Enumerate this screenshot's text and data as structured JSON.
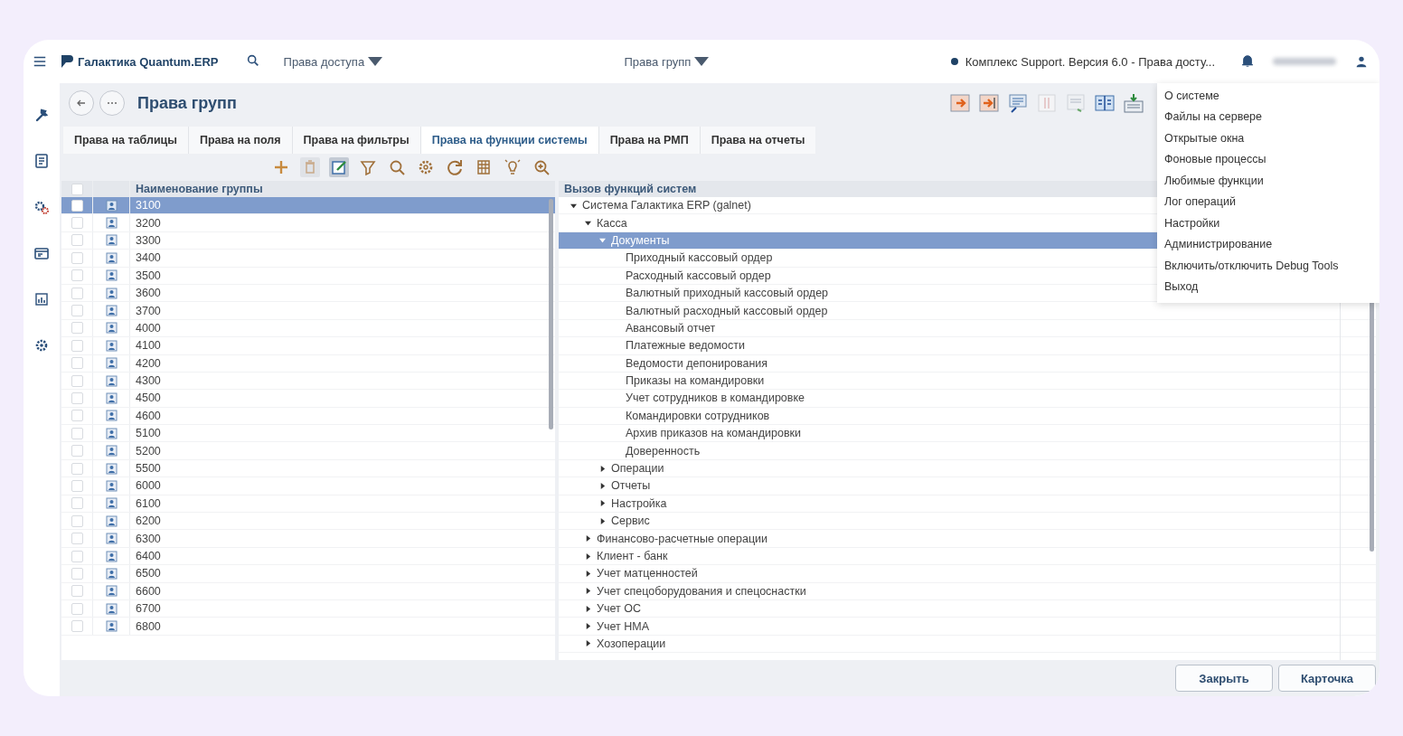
{
  "topbar": {
    "brand": "Галактика Quantum.ERP",
    "module_menu": "Права доступа",
    "window_menu": "Права групп",
    "status": "Комплекс Support. Версия 6.0 - Права досту..."
  },
  "sidebar": {
    "items": [
      {
        "kind": "wrench"
      },
      {
        "kind": "document"
      },
      {
        "kind": "gears"
      },
      {
        "kind": "window"
      },
      {
        "kind": "chart"
      },
      {
        "kind": "gear"
      }
    ]
  },
  "page": {
    "title": "Права групп"
  },
  "tabs": [
    {
      "label": "Права на таблицы",
      "selected": false
    },
    {
      "label": "Права на поля",
      "selected": false
    },
    {
      "label": "Права на фильтры",
      "selected": false
    },
    {
      "label": "Права на функции системы",
      "selected": true
    },
    {
      "label": "Права на РМП",
      "selected": false
    },
    {
      "label": "Права на отчеты",
      "selected": false
    }
  ],
  "groups": {
    "column": "Наименование группы",
    "all_checked": false,
    "rows": [
      {
        "name": "3100",
        "selected": true,
        "checked": false
      },
      {
        "name": "3200",
        "selected": false,
        "checked": false
      },
      {
        "name": "3300",
        "selected": false,
        "checked": false
      },
      {
        "name": "3400",
        "selected": false,
        "checked": false
      },
      {
        "name": "3500",
        "selected": false,
        "checked": false
      },
      {
        "name": "3600",
        "selected": false,
        "checked": false
      },
      {
        "name": "3700",
        "selected": false,
        "checked": false
      },
      {
        "name": "4000",
        "selected": false,
        "checked": false
      },
      {
        "name": "4100",
        "selected": false,
        "checked": false
      },
      {
        "name": "4200",
        "selected": false,
        "checked": false
      },
      {
        "name": "4300",
        "selected": false,
        "checked": false
      },
      {
        "name": "4500",
        "selected": false,
        "checked": false
      },
      {
        "name": "4600",
        "selected": false,
        "checked": false
      },
      {
        "name": "5100",
        "selected": false,
        "checked": false
      },
      {
        "name": "5200",
        "selected": false,
        "checked": false
      },
      {
        "name": "5500",
        "selected": false,
        "checked": false
      },
      {
        "name": "6000",
        "selected": false,
        "checked": false
      },
      {
        "name": "6100",
        "selected": false,
        "checked": false
      },
      {
        "name": "6200",
        "selected": false,
        "checked": false
      },
      {
        "name": "6300",
        "selected": false,
        "checked": false
      },
      {
        "name": "6400",
        "selected": false,
        "checked": false
      },
      {
        "name": "6500",
        "selected": false,
        "checked": false
      },
      {
        "name": "6600",
        "selected": false,
        "checked": false
      },
      {
        "name": "6700",
        "selected": false,
        "checked": false
      },
      {
        "name": "6800",
        "selected": false,
        "checked": false
      }
    ]
  },
  "functions": {
    "column": "Вызов функций систем",
    "tree": [
      {
        "label": "Система Галактика ERP (galnet)",
        "kind": "folder",
        "expanded": true,
        "selected": false,
        "children": [
          {
            "label": "Касса",
            "kind": "folder",
            "expanded": true,
            "selected": false,
            "children": [
              {
                "label": "Документы",
                "kind": "folder",
                "expanded": true,
                "selected": true,
                "children": [
                  {
                    "label": "Приходный кассовый ордер",
                    "kind": "leaf",
                    "selected": false
                  },
                  {
                    "label": "Расходный кассовый ордер",
                    "kind": "leaf",
                    "selected": false
                  },
                  {
                    "label": "Валютный приходный кассовый ордер",
                    "kind": "leaf",
                    "selected": false
                  },
                  {
                    "label": "Валютный расходный кассовый ордер",
                    "kind": "leaf",
                    "selected": false
                  },
                  {
                    "label": "Авансовый отчет",
                    "kind": "leaf",
                    "selected": false
                  },
                  {
                    "label": "Платежные ведомости",
                    "kind": "leaf",
                    "selected": false
                  },
                  {
                    "label": "Ведомости депонирования",
                    "kind": "leaf",
                    "selected": false
                  },
                  {
                    "label": "Приказы на командировки",
                    "kind": "leaf",
                    "selected": false
                  },
                  {
                    "label": "Учет сотрудников в командировке",
                    "kind": "leaf",
                    "selected": false
                  },
                  {
                    "label": "Командировки сотрудников",
                    "kind": "leaf",
                    "selected": false
                  },
                  {
                    "label": "Архив приказов на командировки",
                    "kind": "leaf",
                    "selected": false
                  },
                  {
                    "label": "Доверенность",
                    "kind": "leaf",
                    "selected": false
                  }
                ]
              },
              {
                "label": "Операции",
                "kind": "folder",
                "expanded": false,
                "selected": false
              },
              {
                "label": "Отчеты",
                "kind": "folder",
                "expanded": false,
                "selected": false
              },
              {
                "label": "Настройка",
                "kind": "folder",
                "expanded": false,
                "selected": false
              },
              {
                "label": "Сервис",
                "kind": "folder",
                "expanded": false,
                "selected": false
              }
            ]
          },
          {
            "label": "Финансово-расчетные операции",
            "kind": "folder",
            "expanded": false,
            "selected": false
          },
          {
            "label": "Клиент - банк",
            "kind": "folder",
            "expanded": false,
            "selected": false
          },
          {
            "label": "Учет матценностей",
            "kind": "folder",
            "expanded": false,
            "selected": false
          },
          {
            "label": "Учет спецоборудования и спецоснастки",
            "kind": "folder",
            "expanded": false,
            "selected": false
          },
          {
            "label": "Учет ОС",
            "kind": "folder",
            "expanded": false,
            "selected": false
          },
          {
            "label": "Учет НМА",
            "kind": "folder",
            "expanded": false,
            "selected": false
          },
          {
            "label": "Хозоперации",
            "kind": "folder",
            "expanded": false,
            "selected": false
          }
        ]
      }
    ]
  },
  "user_menu": {
    "items": [
      "О системе",
      "Файлы на сервере",
      "Открытые окна",
      "Фоновые процессы",
      "Любимые функции",
      "Лог операций",
      "Настройки",
      "Администрирование",
      "Включить/отключить Debug Tools",
      "Выход"
    ]
  },
  "buttons": [
    "Закрыть",
    "Карточка"
  ]
}
